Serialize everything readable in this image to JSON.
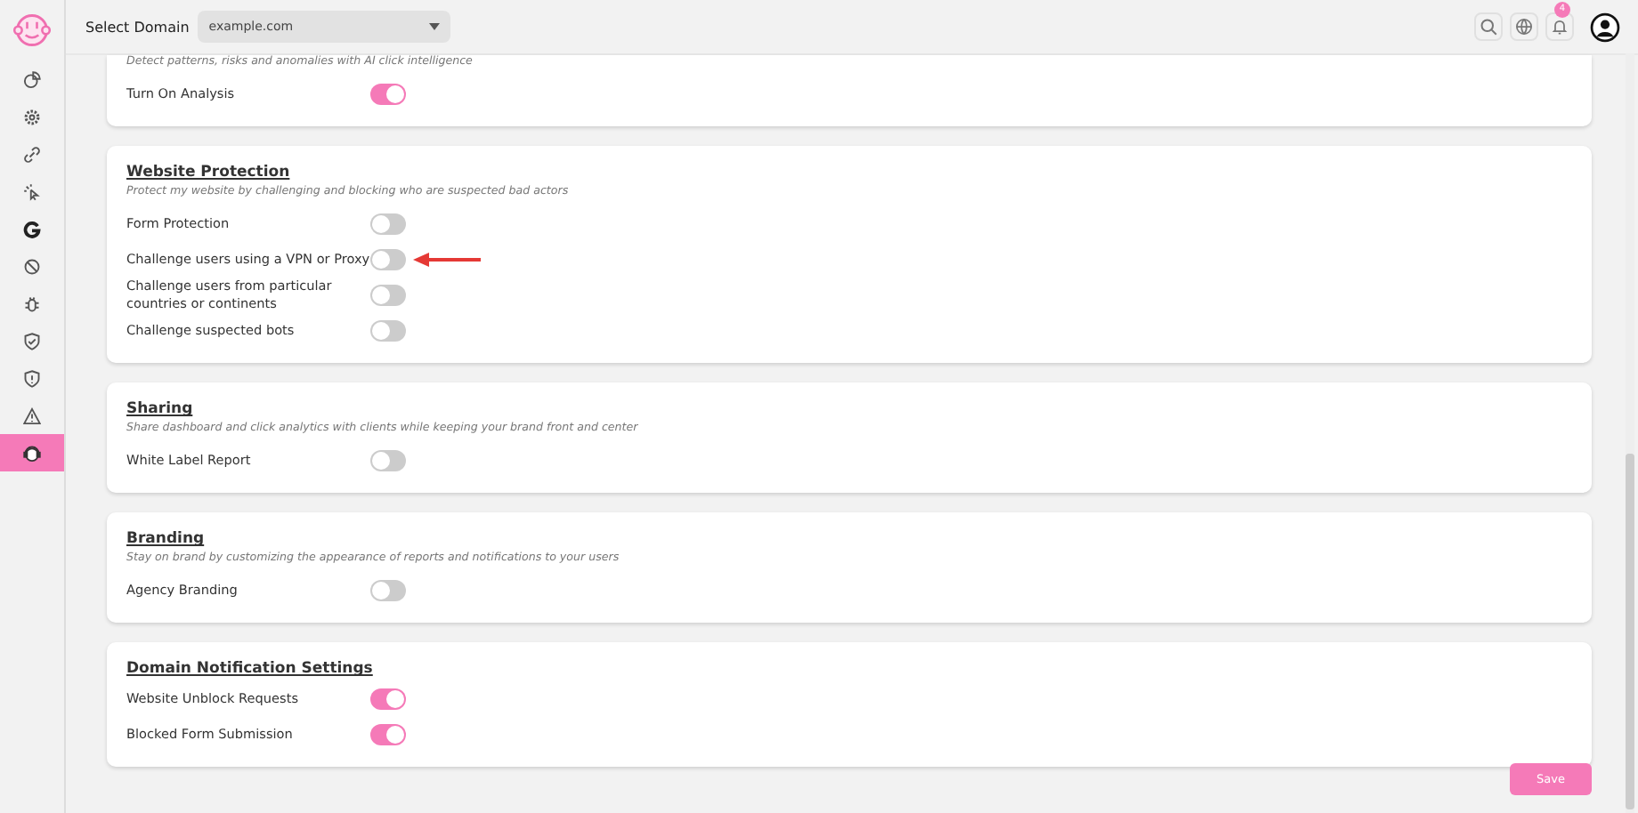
{
  "header": {
    "domain_label": "Select Domain",
    "domain_value": "example.com",
    "notification_count": "4"
  },
  "sidebar": {
    "items": [
      {
        "selected": false
      },
      {
        "selected": false
      },
      {
        "selected": false
      },
      {
        "selected": false
      },
      {
        "selected": false
      },
      {
        "selected": false
      },
      {
        "selected": false
      },
      {
        "selected": false
      },
      {
        "selected": false
      },
      {
        "selected": false
      },
      {
        "selected": true
      }
    ]
  },
  "sections": [
    {
      "description": "Detect patterns, risks and anomalies with AI click intelligence",
      "settings": [
        {
          "label": "Turn On Analysis",
          "on": true
        }
      ]
    },
    {
      "title": "Website Protection",
      "description": "Protect my website by challenging and blocking who are suspected bad actors",
      "settings": [
        {
          "label": "Form Protection",
          "on": false
        },
        {
          "label": "Challenge users using a VPN or Proxy",
          "on": false,
          "arrow": true
        },
        {
          "label": "Challenge users from particular countries or continents",
          "on": false
        },
        {
          "label": "Challenge suspected bots",
          "on": false
        }
      ]
    },
    {
      "title": "Sharing",
      "description": "Share dashboard and click analytics with clients while keeping your brand front and center",
      "settings": [
        {
          "label": "White Label Report",
          "on": false
        }
      ]
    },
    {
      "title": "Branding",
      "description": "Stay on brand by customizing the appearance of reports and notifications to your users",
      "settings": [
        {
          "label": "Agency Branding",
          "on": false
        }
      ]
    },
    {
      "title": "Domain Notification Settings",
      "settings": [
        {
          "label": "Website Unblock Requests",
          "on": true
        },
        {
          "label": "Blocked Form Submission",
          "on": true
        }
      ]
    }
  ],
  "save_button": "Save"
}
